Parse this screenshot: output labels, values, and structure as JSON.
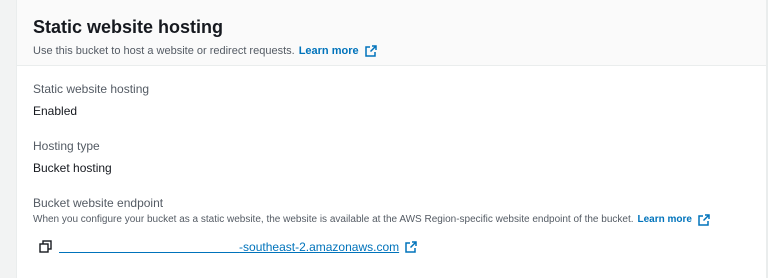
{
  "header": {
    "title": "Static website hosting",
    "description": "Use this bucket to host a website or redirect requests.",
    "learn_more": "Learn more",
    "learn_more_icon": "external-link-icon"
  },
  "fields": {
    "static_hosting": {
      "label": "Static website hosting",
      "value": "Enabled"
    },
    "hosting_type": {
      "label": "Hosting type",
      "value": "Bucket hosting"
    },
    "endpoint": {
      "label": "Bucket website endpoint",
      "description": "When you configure your bucket as a static website, the website is available at the AWS Region-specific website endpoint of the bucket.",
      "learn_more": "Learn more",
      "copy_icon": "copy-icon",
      "url_text": "-southeast-2.amazonaws.com",
      "url_redacted_prefix": "                                                      ",
      "external_icon": "external-link-icon"
    }
  },
  "colors": {
    "link": "#0073bb",
    "label": "#545b64",
    "text": "#16191f",
    "header_bg": "#fafafa",
    "page_bg": "#f2f3f3"
  }
}
